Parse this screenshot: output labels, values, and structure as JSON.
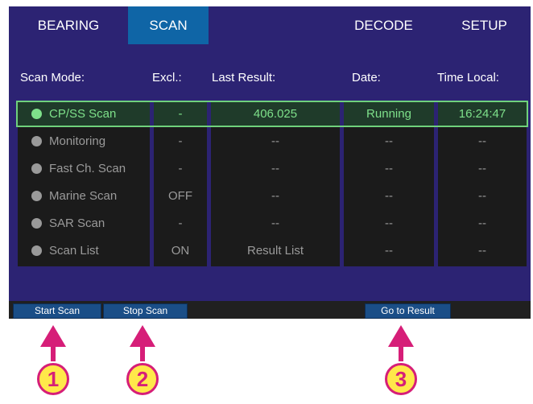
{
  "tabs": [
    {
      "label": "BEARING"
    },
    {
      "label": "SCAN"
    },
    {
      "label": "DECODE"
    },
    {
      "label": "SETUP"
    }
  ],
  "headers": {
    "scan_mode": "Scan Mode:",
    "excl": "Excl.:",
    "last_result": "Last Result:",
    "date": "Date:",
    "time_local": "Time Local:"
  },
  "rows": [
    {
      "mode": "CP/SS Scan",
      "excl": "-",
      "last": "406.025",
      "date": "Running",
      "time": "16:24:47",
      "active": true
    },
    {
      "mode": "Monitoring",
      "excl": "-",
      "last": "--",
      "date": "--",
      "time": "--"
    },
    {
      "mode": "Fast Ch. Scan",
      "excl": "-",
      "last": "--",
      "date": "--",
      "time": "--"
    },
    {
      "mode": "Marine Scan",
      "excl": "OFF",
      "last": "--",
      "date": "--",
      "time": "--"
    },
    {
      "mode": "SAR Scan",
      "excl": "-",
      "last": "--",
      "date": "--",
      "time": "--"
    },
    {
      "mode": "Scan List",
      "excl": "ON",
      "last": "Result List",
      "date": "--",
      "time": "--"
    }
  ],
  "actions": {
    "start_scan": "Start Scan",
    "stop_scan": "Stop Scan",
    "go_to_result": "Go to Result"
  },
  "callouts": [
    "1",
    "2",
    "3"
  ],
  "colors": {
    "screen_bg": "#2c2373",
    "active_tab": "#0f65a6",
    "active_row": "#7ee08a",
    "callout_fill": "#ffe84a",
    "callout_stroke": "#d61e78"
  }
}
